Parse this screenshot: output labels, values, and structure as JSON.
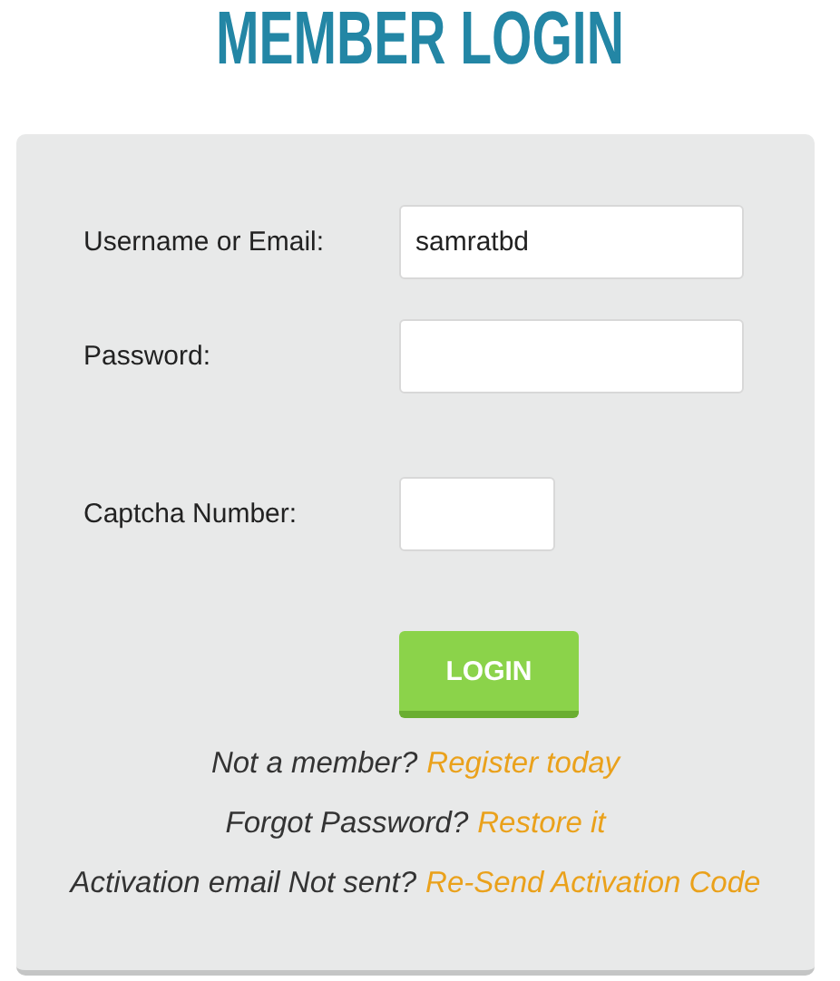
{
  "title": "MEMBER LOGIN",
  "fields": [
    {
      "kind": "text",
      "label": "Username or Email:",
      "value": "samratbd"
    },
    {
      "kind": "password",
      "label": "Password:"
    },
    {
      "kind": "captcha",
      "label": "Captcha Number:"
    }
  ],
  "button": "LOGIN",
  "links": [
    {
      "prompt": "Not a member?",
      "link": "Register today"
    },
    {
      "prompt": "Forgot Password?",
      "link": "Restore it"
    },
    {
      "prompt": "Activation email Not sent?",
      "link": "Re-Send Activation Code"
    }
  ]
}
